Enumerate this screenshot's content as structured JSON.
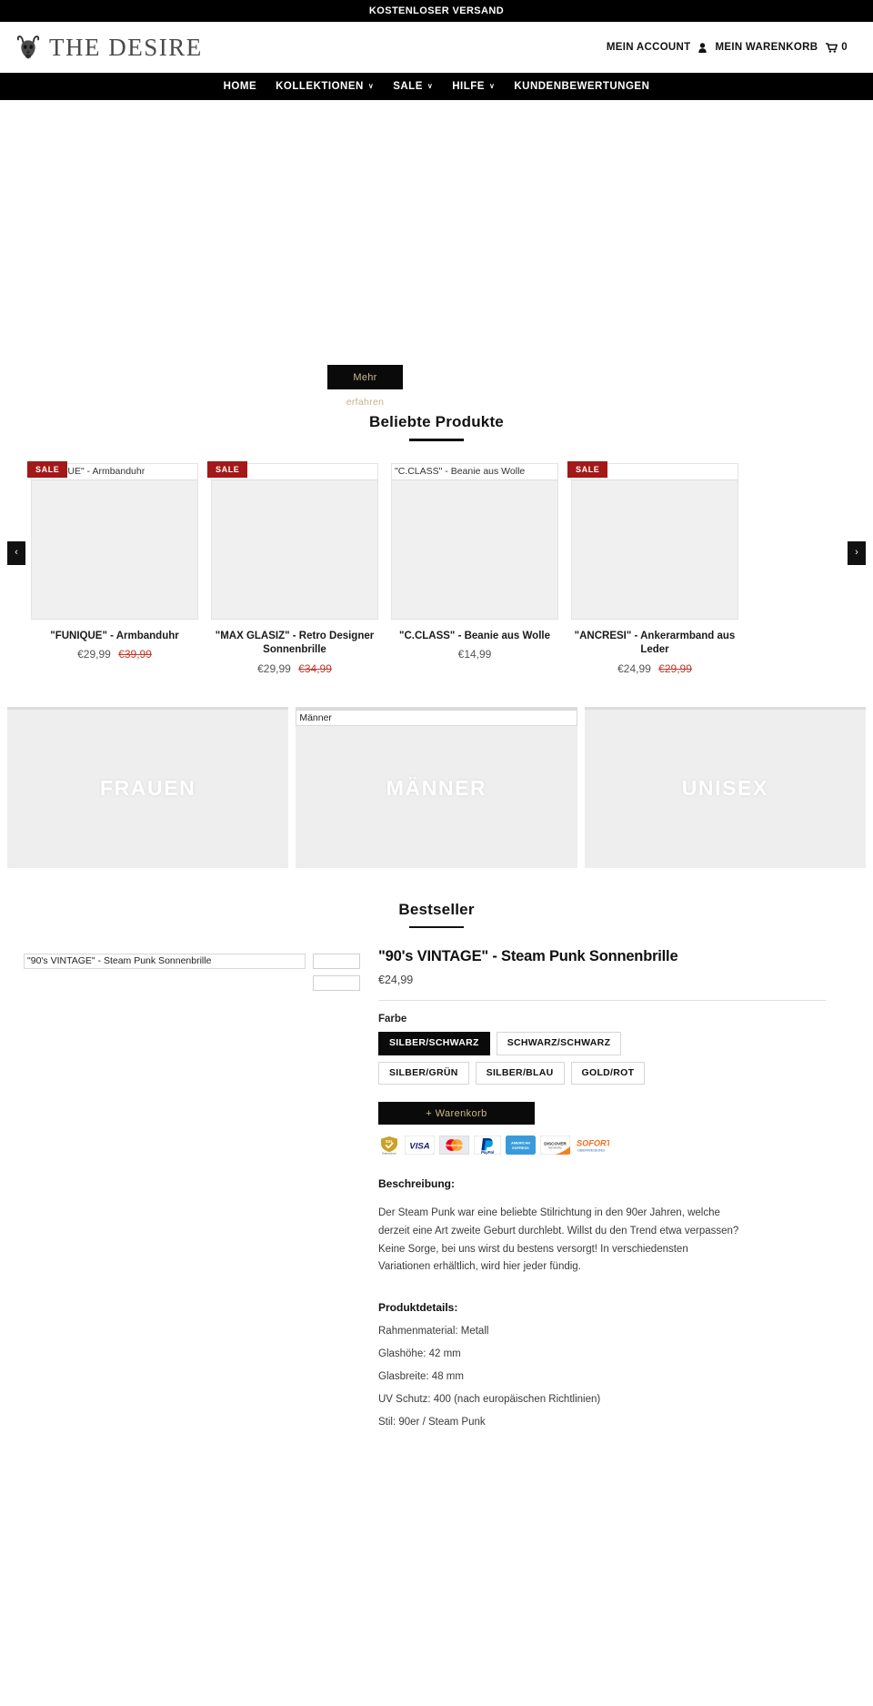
{
  "announcement": {
    "text": "KOSTENLOSER VERSAND"
  },
  "header": {
    "logo_text": "THE DESIRE",
    "logo_icon": "bull-skull-icon",
    "account_label": "MEIN ACCOUNT",
    "account_icon": "person-icon",
    "cart_label": "MEIN WARENKORB",
    "cart_icon": "cart-icon",
    "cart_count": "0"
  },
  "nav": {
    "items": [
      {
        "label": "HOME",
        "has_dropdown": false
      },
      {
        "label": "KOLLEKTIONEN",
        "has_dropdown": true
      },
      {
        "label": "SALE",
        "has_dropdown": true
      },
      {
        "label": "HILFE",
        "has_dropdown": true
      },
      {
        "label": "KUNDENBEWERTUNGEN",
        "has_dropdown": false
      }
    ],
    "chevron": "∨"
  },
  "hero": {
    "button_label": "Mehr",
    "sub_label": "erfahren"
  },
  "popular": {
    "title": "Beliebte Produkte",
    "prev_arrow": "‹",
    "next_arrow": "›",
    "sale_badge": "SALE",
    "products": [
      {
        "name": "\"FUNIQUE\" - Armbanduhr",
        "alt": "\"FUNIQUE\" - Armbanduhr",
        "price": "€29,99",
        "old_price": "€39,99",
        "on_sale": true
      },
      {
        "name": "\"MAX GLASIZ\" - Retro Designer Sonnenbrille",
        "alt": "",
        "price": "€29,99",
        "old_price": "€34,99",
        "on_sale": true
      },
      {
        "name": "\"C.CLASS\" - Beanie aus Wolle",
        "alt": "\"C.CLASS\" - Beanie aus Wolle",
        "price": "€14,99",
        "old_price": "",
        "on_sale": false
      },
      {
        "name": "\"ANCRESI\" - Ankerarmband aus Leder",
        "alt": "",
        "price": "€24,99",
        "old_price": "€29,99",
        "on_sale": true
      }
    ]
  },
  "categories": [
    {
      "label": "FRAUEN",
      "alt": ""
    },
    {
      "label": "MÄNNER",
      "alt": "Männer"
    },
    {
      "label": "UNISEX",
      "alt": ""
    }
  ],
  "bestseller": {
    "title": "Bestseller",
    "gallery_alt": "\"90's VINTAGE\" - Steam Punk Sonnenbrille",
    "product_title": "\"90's VINTAGE\" - Steam Punk Sonnenbrille",
    "price": "€24,99",
    "option_label": "Farbe",
    "variants": [
      {
        "label": "SILBER/SCHWARZ",
        "selected": true
      },
      {
        "label": "SCHWARZ/SCHWARZ",
        "selected": false
      },
      {
        "label": "SILBER/GRÜN",
        "selected": false
      },
      {
        "label": "SILBER/BLAU",
        "selected": false
      },
      {
        "label": "GOLD/ROT",
        "selected": false
      }
    ],
    "cart_button": "+ Warenkorb",
    "payment_badges": [
      "ssl-datenschutz-badge",
      "visa-badge",
      "mastercard-badge",
      "paypal-badge",
      "american-express-badge",
      "discover-badge",
      "sofort-ueberweisung-badge"
    ],
    "description_heading": "Beschreibung:",
    "description_body": "Der Steam Punk war eine beliebte Stilrichtung in den 90er Jahren, welche derzeit eine Art zweite Geburt durchlebt. Willst du den Trend etwa verpassen? Keine Sorge, bei uns wirst du bestens versorgt! In verschiedensten Variationen erhältlich, wird hier jeder fündig.",
    "details_heading": "Produktdetails:",
    "details": [
      "Rahmenmaterial: Metall",
      "Glashöhe: 42 mm",
      "Glasbreite: 48 mm",
      "UV Schutz: 400 (nach europäischen Richtlinien)",
      "Stil: 90er / Steam Punk"
    ]
  },
  "colors": {
    "accent_gold": "#c9b98d",
    "sale_red": "#a31818",
    "strike_red": "#c0392b",
    "nav_black": "#000000"
  }
}
